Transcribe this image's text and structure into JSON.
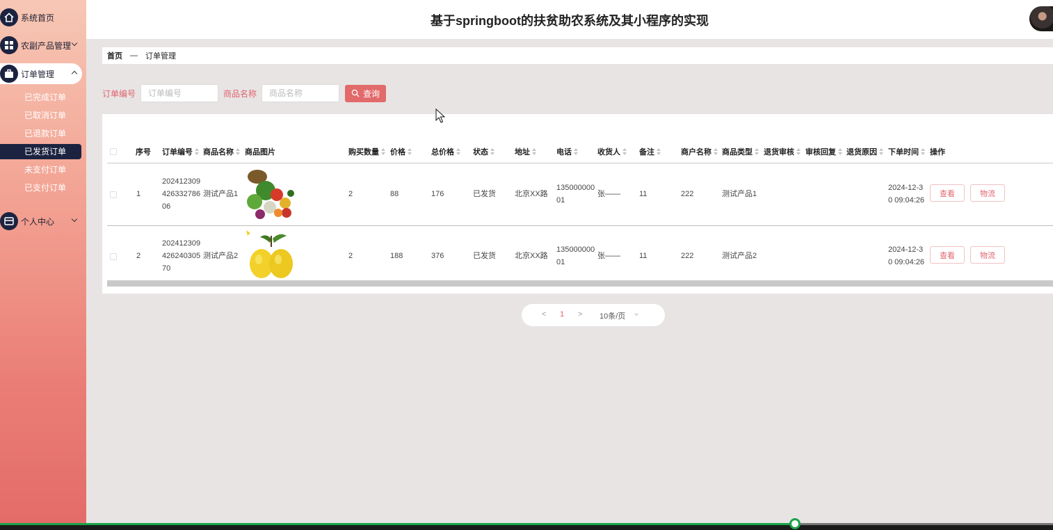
{
  "header": {
    "title": "基于springboot的扶贫助农系统及其小程序的实现"
  },
  "sidebar": {
    "items": [
      {
        "label": "系统首页",
        "icon": "home-icon"
      },
      {
        "label": "农副产品管理",
        "icon": "grid-icon"
      },
      {
        "label": "订单管理",
        "icon": "briefcase-icon"
      },
      {
        "label": "个人中心",
        "icon": "wallet-icon"
      }
    ],
    "sub_items": [
      "已完成订单",
      "已取消订单",
      "已退款订单",
      "已发货订单",
      "未支付订单",
      "已支付订单"
    ]
  },
  "breadcrumb": {
    "home": "首页",
    "sep": "—",
    "current": "订单管理"
  },
  "search": {
    "order_no_label": "订单编号",
    "order_no_placeholder": "订单编号",
    "product_label": "商品名称",
    "product_placeholder": "商品名称",
    "query_label": "查询"
  },
  "table": {
    "columns": [
      "序号",
      "订单编号",
      "商品名称",
      "商品图片",
      "购买数量",
      "价格",
      "总价格",
      "状态",
      "地址",
      "电话",
      "收货人",
      "备注",
      "商户名称",
      "商品类型",
      "退货审核",
      "审核回复",
      "退货原因",
      "下单时间",
      "操作"
    ],
    "rows": [
      {
        "index": "1",
        "order_no_1": "202412309",
        "order_no_2": "426332786",
        "order_no_3": "06",
        "product": "测试产品1",
        "image": "vegetables-image",
        "qty": "2",
        "price": "88",
        "total": "176",
        "status": "已发货",
        "address": "北京XX路",
        "phone_1": "135000000",
        "phone_2": "01",
        "receiver": "张——",
        "remark": "11",
        "merchant": "222",
        "type": "测试产品1",
        "time_1": "2024-12-3",
        "time_2": "0 09:04:26"
      },
      {
        "index": "2",
        "order_no_1": "202412309",
        "order_no_2": "426240305",
        "order_no_3": "70",
        "product_1": "测试产品2",
        "product_2": "",
        "image": "pears-image",
        "qty": "2",
        "price": "188",
        "total": "376",
        "status": "已发货",
        "address": "北京XX路",
        "phone_1": "135000000",
        "phone_2": "01",
        "receiver": "张——",
        "remark": "11",
        "merchant": "222",
        "type": "测试产品2",
        "time_1": "2024-12-3",
        "time_2": "0 09:04:26"
      }
    ],
    "actions": {
      "view": "查看",
      "logistics": "物流"
    }
  },
  "pagination": {
    "prev": "<",
    "current": "1",
    "next": ">",
    "page_size": "10条/页"
  },
  "video": {
    "progress": 0.755
  },
  "colors": {
    "accent": "#e0646e",
    "nav_dark": "#1c2340",
    "progress_green": "#1ba34a"
  }
}
